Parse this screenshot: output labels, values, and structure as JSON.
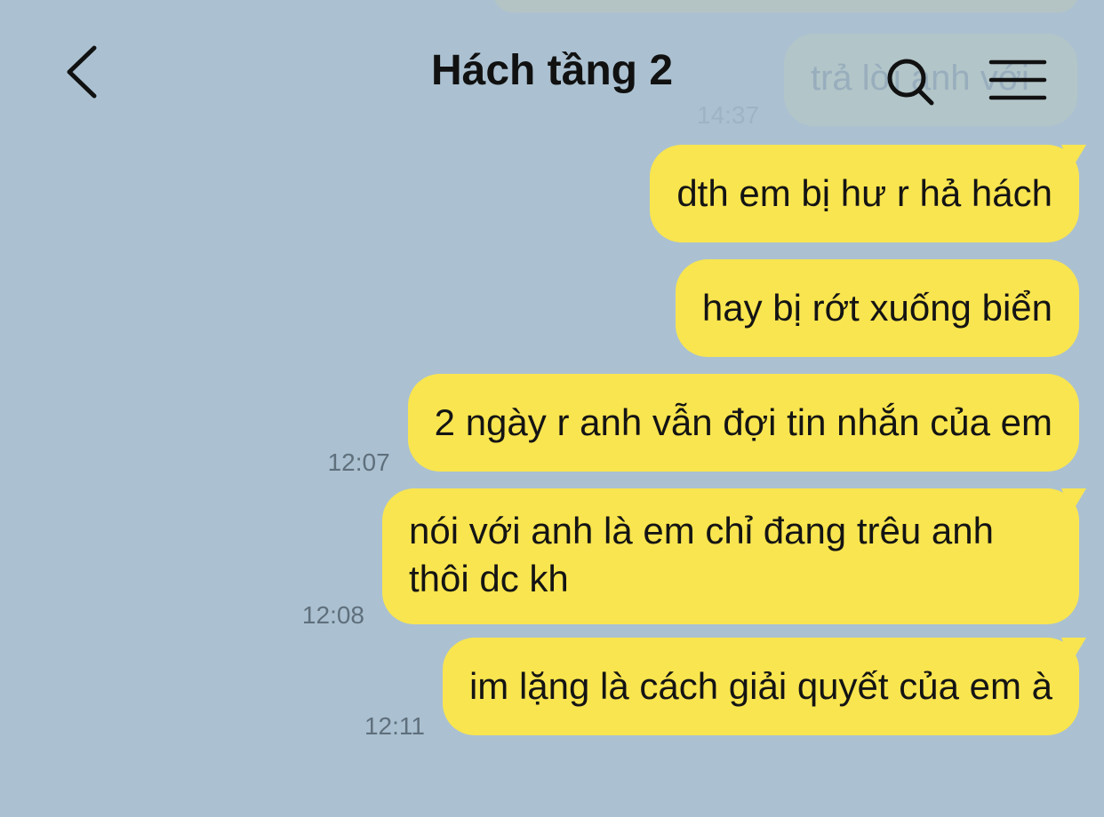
{
  "header": {
    "title": "Hách tầng 2"
  },
  "faded_previous": {
    "message_text": "trả lời anh với",
    "time": "14:37"
  },
  "messages": [
    {
      "text": "dth em bị hư r hả hách",
      "time": ""
    },
    {
      "text": "hay bị rớt xuống biển",
      "time": ""
    },
    {
      "text": "2 ngày r anh vẫn đợi tin nhắn của em",
      "time": "12:07"
    },
    {
      "text": "nói với anh là em chỉ đang trêu anh thôi dc kh",
      "time": "12:08"
    },
    {
      "text": "im lặng là cách giải quyết của em à",
      "time": "12:11"
    }
  ],
  "colors": {
    "background": "#abc1d1",
    "sent_bubble": "#f9e54f",
    "text": "#141414",
    "timestamp": "#5f6f7c"
  },
  "icons": [
    "back-arrow-icon",
    "search-icon",
    "menu-icon"
  ]
}
